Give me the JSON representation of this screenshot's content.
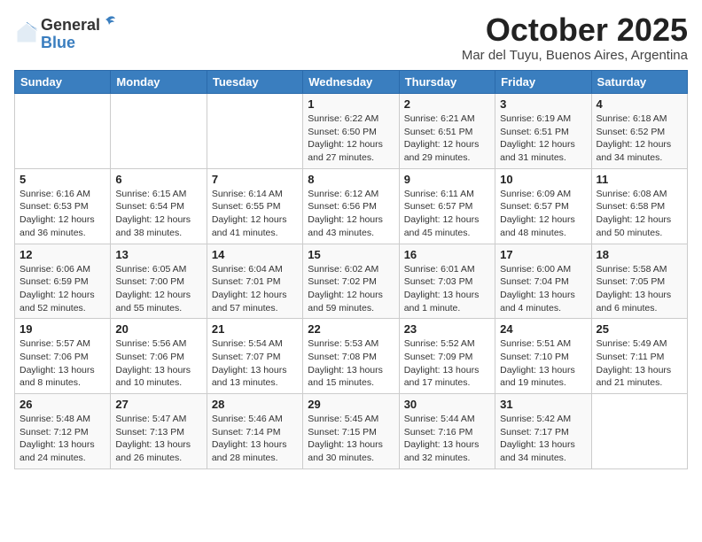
{
  "header": {
    "logo_general": "General",
    "logo_blue": "Blue",
    "month": "October 2025",
    "location": "Mar del Tuyu, Buenos Aires, Argentina"
  },
  "columns": [
    "Sunday",
    "Monday",
    "Tuesday",
    "Wednesday",
    "Thursday",
    "Friday",
    "Saturday"
  ],
  "weeks": [
    [
      {
        "day": "",
        "text": ""
      },
      {
        "day": "",
        "text": ""
      },
      {
        "day": "",
        "text": ""
      },
      {
        "day": "1",
        "text": "Sunrise: 6:22 AM\nSunset: 6:50 PM\nDaylight: 12 hours and 27 minutes."
      },
      {
        "day": "2",
        "text": "Sunrise: 6:21 AM\nSunset: 6:51 PM\nDaylight: 12 hours and 29 minutes."
      },
      {
        "day": "3",
        "text": "Sunrise: 6:19 AM\nSunset: 6:51 PM\nDaylight: 12 hours and 31 minutes."
      },
      {
        "day": "4",
        "text": "Sunrise: 6:18 AM\nSunset: 6:52 PM\nDaylight: 12 hours and 34 minutes."
      }
    ],
    [
      {
        "day": "5",
        "text": "Sunrise: 6:16 AM\nSunset: 6:53 PM\nDaylight: 12 hours and 36 minutes."
      },
      {
        "day": "6",
        "text": "Sunrise: 6:15 AM\nSunset: 6:54 PM\nDaylight: 12 hours and 38 minutes."
      },
      {
        "day": "7",
        "text": "Sunrise: 6:14 AM\nSunset: 6:55 PM\nDaylight: 12 hours and 41 minutes."
      },
      {
        "day": "8",
        "text": "Sunrise: 6:12 AM\nSunset: 6:56 PM\nDaylight: 12 hours and 43 minutes."
      },
      {
        "day": "9",
        "text": "Sunrise: 6:11 AM\nSunset: 6:57 PM\nDaylight: 12 hours and 45 minutes."
      },
      {
        "day": "10",
        "text": "Sunrise: 6:09 AM\nSunset: 6:57 PM\nDaylight: 12 hours and 48 minutes."
      },
      {
        "day": "11",
        "text": "Sunrise: 6:08 AM\nSunset: 6:58 PM\nDaylight: 12 hours and 50 minutes."
      }
    ],
    [
      {
        "day": "12",
        "text": "Sunrise: 6:06 AM\nSunset: 6:59 PM\nDaylight: 12 hours and 52 minutes."
      },
      {
        "day": "13",
        "text": "Sunrise: 6:05 AM\nSunset: 7:00 PM\nDaylight: 12 hours and 55 minutes."
      },
      {
        "day": "14",
        "text": "Sunrise: 6:04 AM\nSunset: 7:01 PM\nDaylight: 12 hours and 57 minutes."
      },
      {
        "day": "15",
        "text": "Sunrise: 6:02 AM\nSunset: 7:02 PM\nDaylight: 12 hours and 59 minutes."
      },
      {
        "day": "16",
        "text": "Sunrise: 6:01 AM\nSunset: 7:03 PM\nDaylight: 13 hours and 1 minute."
      },
      {
        "day": "17",
        "text": "Sunrise: 6:00 AM\nSunset: 7:04 PM\nDaylight: 13 hours and 4 minutes."
      },
      {
        "day": "18",
        "text": "Sunrise: 5:58 AM\nSunset: 7:05 PM\nDaylight: 13 hours and 6 minutes."
      }
    ],
    [
      {
        "day": "19",
        "text": "Sunrise: 5:57 AM\nSunset: 7:06 PM\nDaylight: 13 hours and 8 minutes."
      },
      {
        "day": "20",
        "text": "Sunrise: 5:56 AM\nSunset: 7:06 PM\nDaylight: 13 hours and 10 minutes."
      },
      {
        "day": "21",
        "text": "Sunrise: 5:54 AM\nSunset: 7:07 PM\nDaylight: 13 hours and 13 minutes."
      },
      {
        "day": "22",
        "text": "Sunrise: 5:53 AM\nSunset: 7:08 PM\nDaylight: 13 hours and 15 minutes."
      },
      {
        "day": "23",
        "text": "Sunrise: 5:52 AM\nSunset: 7:09 PM\nDaylight: 13 hours and 17 minutes."
      },
      {
        "day": "24",
        "text": "Sunrise: 5:51 AM\nSunset: 7:10 PM\nDaylight: 13 hours and 19 minutes."
      },
      {
        "day": "25",
        "text": "Sunrise: 5:49 AM\nSunset: 7:11 PM\nDaylight: 13 hours and 21 minutes."
      }
    ],
    [
      {
        "day": "26",
        "text": "Sunrise: 5:48 AM\nSunset: 7:12 PM\nDaylight: 13 hours and 24 minutes."
      },
      {
        "day": "27",
        "text": "Sunrise: 5:47 AM\nSunset: 7:13 PM\nDaylight: 13 hours and 26 minutes."
      },
      {
        "day": "28",
        "text": "Sunrise: 5:46 AM\nSunset: 7:14 PM\nDaylight: 13 hours and 28 minutes."
      },
      {
        "day": "29",
        "text": "Sunrise: 5:45 AM\nSunset: 7:15 PM\nDaylight: 13 hours and 30 minutes."
      },
      {
        "day": "30",
        "text": "Sunrise: 5:44 AM\nSunset: 7:16 PM\nDaylight: 13 hours and 32 minutes."
      },
      {
        "day": "31",
        "text": "Sunrise: 5:42 AM\nSunset: 7:17 PM\nDaylight: 13 hours and 34 minutes."
      },
      {
        "day": "",
        "text": ""
      }
    ]
  ]
}
